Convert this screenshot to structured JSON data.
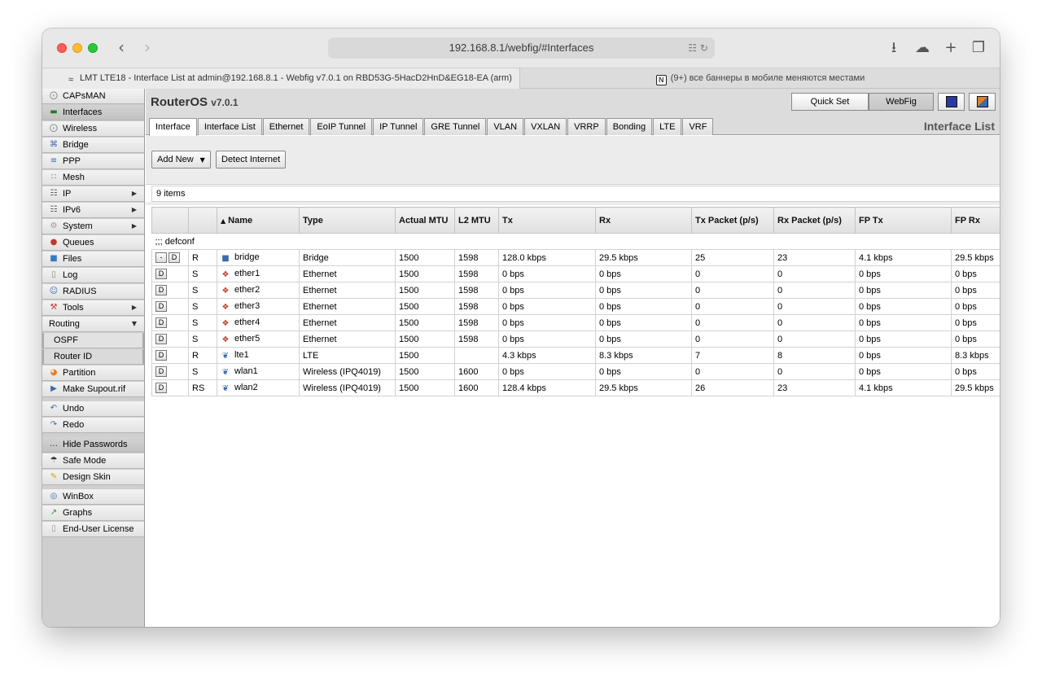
{
  "browser": {
    "url": "192.168.8.1/webfig/#Interfaces",
    "tabs": [
      {
        "label": "LMT LTE18 - Interface List at admin@192.168.8.1 - Webfig v7.0.1 on RBD53G-5HacD2HnD&EG18-EA (arm)"
      },
      {
        "label": "(9+) все баннеры в мобиле меняются местами"
      }
    ]
  },
  "header": {
    "brand": "RouterOS",
    "version": "v7.0.1",
    "quick_set": "Quick Set",
    "webfig": "WebFig",
    "list_title": "Interface List"
  },
  "sidebar": {
    "items": [
      {
        "label": "CAPsMAN",
        "icon": "capsman-icon"
      },
      {
        "label": "Interfaces",
        "icon": "interfaces-icon"
      },
      {
        "label": "Wireless",
        "icon": "wireless-icon"
      },
      {
        "label": "Bridge",
        "icon": "bridge-icon"
      },
      {
        "label": "PPP",
        "icon": "ppp-icon"
      },
      {
        "label": "Mesh",
        "icon": "mesh-icon"
      },
      {
        "label": "IP",
        "icon": "ip-icon"
      },
      {
        "label": "IPv6",
        "icon": "ipv6-icon"
      },
      {
        "label": "System",
        "icon": "system-icon"
      },
      {
        "label": "Queues",
        "icon": "queues-icon"
      },
      {
        "label": "Files",
        "icon": "files-icon"
      },
      {
        "label": "Log",
        "icon": "log-icon"
      },
      {
        "label": "RADIUS",
        "icon": "radius-icon"
      },
      {
        "label": "Tools",
        "icon": "tools-icon"
      },
      {
        "label": "Routing",
        "icon": ""
      },
      {
        "label": "OSPF",
        "icon": ""
      },
      {
        "label": "Router ID",
        "icon": ""
      },
      {
        "label": "Partition",
        "icon": "partition-icon"
      },
      {
        "label": "Make Supout.rif",
        "icon": "supout-icon"
      },
      {
        "label": "Undo",
        "icon": "undo-icon"
      },
      {
        "label": "Redo",
        "icon": "redo-icon"
      },
      {
        "label": "Hide Passwords",
        "icon": "hide-passwords-icon"
      },
      {
        "label": "Safe Mode",
        "icon": "safe-mode-icon"
      },
      {
        "label": "Design Skin",
        "icon": "design-skin-icon"
      },
      {
        "label": "WinBox",
        "icon": "winbox-icon"
      },
      {
        "label": "Graphs",
        "icon": "graphs-icon"
      },
      {
        "label": "End-User License",
        "icon": "license-icon"
      }
    ]
  },
  "subtabs": [
    {
      "label": "Interface"
    },
    {
      "label": "Interface List"
    },
    {
      "label": "Ethernet"
    },
    {
      "label": "EoIP Tunnel"
    },
    {
      "label": "IP Tunnel"
    },
    {
      "label": "GRE Tunnel"
    },
    {
      "label": "VLAN"
    },
    {
      "label": "VXLAN"
    },
    {
      "label": "VRRP"
    },
    {
      "label": "Bonding"
    },
    {
      "label": "LTE"
    },
    {
      "label": "VRF"
    }
  ],
  "actions": {
    "add_new": "Add New",
    "detect_internet": "Detect Internet"
  },
  "table": {
    "count": "9 items",
    "comment": ";;; defconf",
    "columns": [
      "",
      "",
      "Name",
      "Type",
      "Actual MTU",
      "L2 MTU",
      "Tx",
      "Rx",
      "Tx Packet (p/s)",
      "Rx Packet (p/s)",
      "FP Tx",
      "FP Rx"
    ],
    "rows": [
      {
        "btn1": "-",
        "btn2": "D",
        "flag": "R",
        "name": "bridge",
        "type": "Bridge",
        "amtu": "1500",
        "l2mtu": "1598",
        "tx": "128.0 kbps",
        "rx": "29.5 kbps",
        "txp": "25",
        "rxp": "23",
        "fptx": "4.1 kbps",
        "fprx": "29.5 kbps"
      },
      {
        "btn1": "",
        "btn2": "D",
        "flag": "S",
        "name": "ether1",
        "type": "Ethernet",
        "amtu": "1500",
        "l2mtu": "1598",
        "tx": "0 bps",
        "rx": "0 bps",
        "txp": "0",
        "rxp": "0",
        "fptx": "0 bps",
        "fprx": "0 bps"
      },
      {
        "btn1": "",
        "btn2": "D",
        "flag": "S",
        "name": "ether2",
        "type": "Ethernet",
        "amtu": "1500",
        "l2mtu": "1598",
        "tx": "0 bps",
        "rx": "0 bps",
        "txp": "0",
        "rxp": "0",
        "fptx": "0 bps",
        "fprx": "0 bps"
      },
      {
        "btn1": "",
        "btn2": "D",
        "flag": "S",
        "name": "ether3",
        "type": "Ethernet",
        "amtu": "1500",
        "l2mtu": "1598",
        "tx": "0 bps",
        "rx": "0 bps",
        "txp": "0",
        "rxp": "0",
        "fptx": "0 bps",
        "fprx": "0 bps"
      },
      {
        "btn1": "",
        "btn2": "D",
        "flag": "S",
        "name": "ether4",
        "type": "Ethernet",
        "amtu": "1500",
        "l2mtu": "1598",
        "tx": "0 bps",
        "rx": "0 bps",
        "txp": "0",
        "rxp": "0",
        "fptx": "0 bps",
        "fprx": "0 bps"
      },
      {
        "btn1": "",
        "btn2": "D",
        "flag": "S",
        "name": "ether5",
        "type": "Ethernet",
        "amtu": "1500",
        "l2mtu": "1598",
        "tx": "0 bps",
        "rx": "0 bps",
        "txp": "0",
        "rxp": "0",
        "fptx": "0 bps",
        "fprx": "0 bps"
      },
      {
        "btn1": "",
        "btn2": "D",
        "flag": "R",
        "name": "lte1",
        "type": "LTE",
        "amtu": "1500",
        "l2mtu": "",
        "tx": "4.3 kbps",
        "rx": "8.3 kbps",
        "txp": "7",
        "rxp": "8",
        "fptx": "0 bps",
        "fprx": "8.3 kbps"
      },
      {
        "btn1": "",
        "btn2": "D",
        "flag": "S",
        "name": "wlan1",
        "type": "Wireless (IPQ4019)",
        "amtu": "1500",
        "l2mtu": "1600",
        "tx": "0 bps",
        "rx": "0 bps",
        "txp": "0",
        "rxp": "0",
        "fptx": "0 bps",
        "fprx": "0 bps"
      },
      {
        "btn1": "",
        "btn2": "D",
        "flag": "RS",
        "name": "wlan2",
        "type": "Wireless (IPQ4019)",
        "amtu": "1500",
        "l2mtu": "1600",
        "tx": "128.4 kbps",
        "rx": "29.5 kbps",
        "txp": "26",
        "rxp": "23",
        "fptx": "4.1 kbps",
        "fprx": "29.5 kbps"
      }
    ]
  }
}
